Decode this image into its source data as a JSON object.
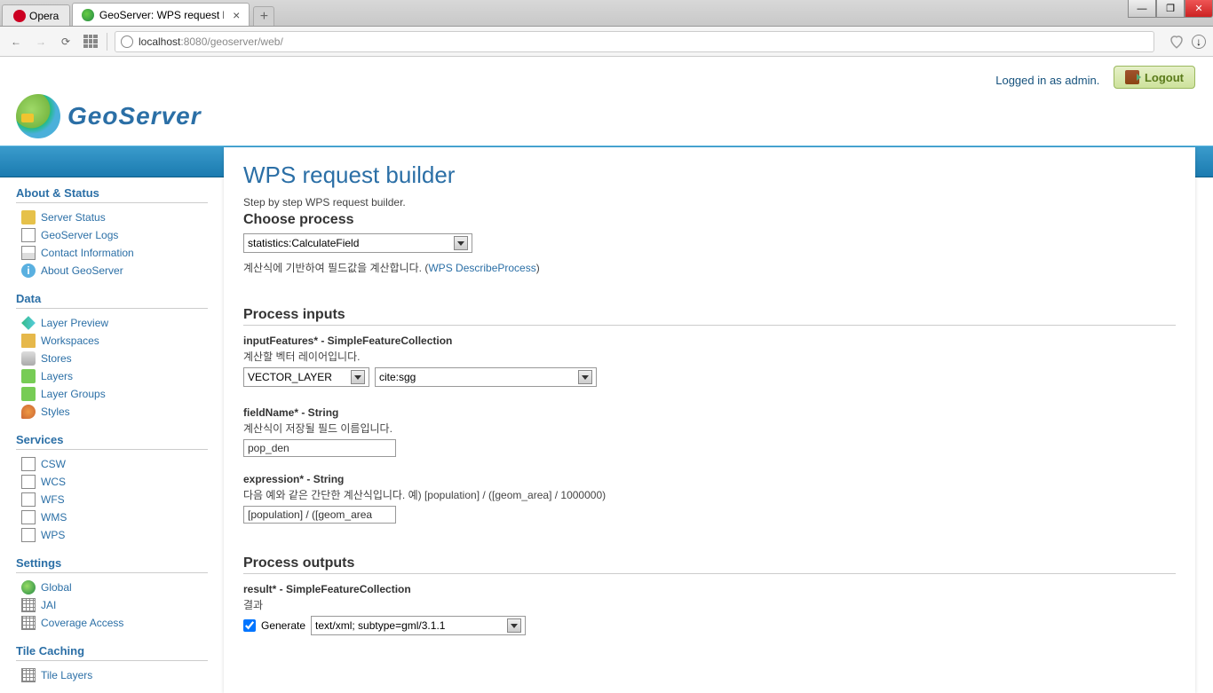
{
  "browser": {
    "tab_opera": "Opera",
    "tab_active": "GeoServer: WPS request b",
    "url_host": "localhost",
    "url_path": ":8080/geoserver/web/"
  },
  "header": {
    "login_text": "Logged in as admin.",
    "logout": "Logout",
    "brand": "GeoServer"
  },
  "sidebar": {
    "about_title": "About & Status",
    "about": [
      "Server Status",
      "GeoServer Logs",
      "Contact Information",
      "About GeoServer"
    ],
    "data_title": "Data",
    "data": [
      "Layer Preview",
      "Workspaces",
      "Stores",
      "Layers",
      "Layer Groups",
      "Styles"
    ],
    "services_title": "Services",
    "services": [
      "CSW",
      "WCS",
      "WFS",
      "WMS",
      "WPS"
    ],
    "settings_title": "Settings",
    "settings": [
      "Global",
      "JAI",
      "Coverage Access"
    ],
    "tile_title": "Tile Caching",
    "tile": [
      "Tile Layers"
    ]
  },
  "main": {
    "title": "WPS request builder",
    "subtitle": "Step by step WPS request builder.",
    "choose_process": "Choose process",
    "process_select": "statistics:CalculateField",
    "process_desc": "계산식에 기반하여 필드값을 계산합니다. (",
    "process_link": "WPS DescribeProcess",
    "process_desc_end": ")",
    "inputs_title": "Process inputs",
    "inputFeatures_label": "inputFeatures* - SimpleFeatureCollection",
    "inputFeatures_desc": "계산할 벡터 레이어입니다.",
    "inputFeatures_type": "VECTOR_LAYER",
    "inputFeatures_layer": "cite:sgg",
    "fieldName_label": "fieldName* - String",
    "fieldName_desc": "계산식이 저장될 필드 이름입니다.",
    "fieldName_value": "pop_den",
    "expression_label": "expression* - String",
    "expression_desc": "다음 예와 같은 간단한 계산식입니다. 예) [population] / ([geom_area] / 1000000)",
    "expression_value": "[population] / ([geom_area",
    "outputs_title": "Process outputs",
    "result_label": "result* - SimpleFeatureCollection",
    "result_desc": "결과",
    "generate_label": "Generate",
    "generate_format": "text/xml; subtype=gml/3.1.1"
  }
}
